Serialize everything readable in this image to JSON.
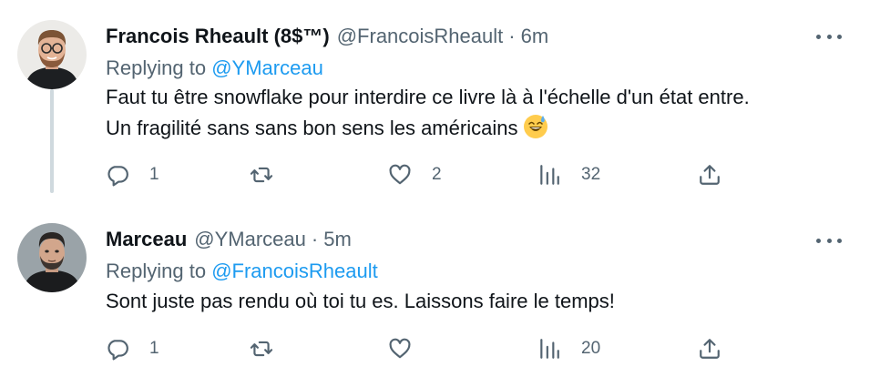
{
  "tweets": [
    {
      "name": "Francois Rheault (8$™)",
      "handle": "@FrancoisRheault",
      "separator": "·",
      "time": "6m",
      "replying_prefix": "Replying to",
      "replying_to": "@YMarceau",
      "text_line1": "Faut tu être snowflake pour interdire ce livre là à l'échelle d'un état entre.",
      "text_line2": "Un fragilité sans sans bon sens les américains",
      "emoji": "grinning-face-with-sweat",
      "replies": "1",
      "retweets": "",
      "likes": "2",
      "views": "32"
    },
    {
      "name": "Marceau",
      "handle": "@YMarceau",
      "separator": "·",
      "time": "5m",
      "replying_prefix": "Replying to",
      "replying_to": "@FrancoisRheault",
      "text_line1": "Sont juste pas rendu où toi tu es. Laissons faire le temps!",
      "replies": "1",
      "retweets": "",
      "likes": "",
      "views": "20"
    }
  ],
  "colors": {
    "text": "#0f1419",
    "secondary": "#536471",
    "link": "#1d9bf0",
    "thread_line": "#cfd9de"
  }
}
